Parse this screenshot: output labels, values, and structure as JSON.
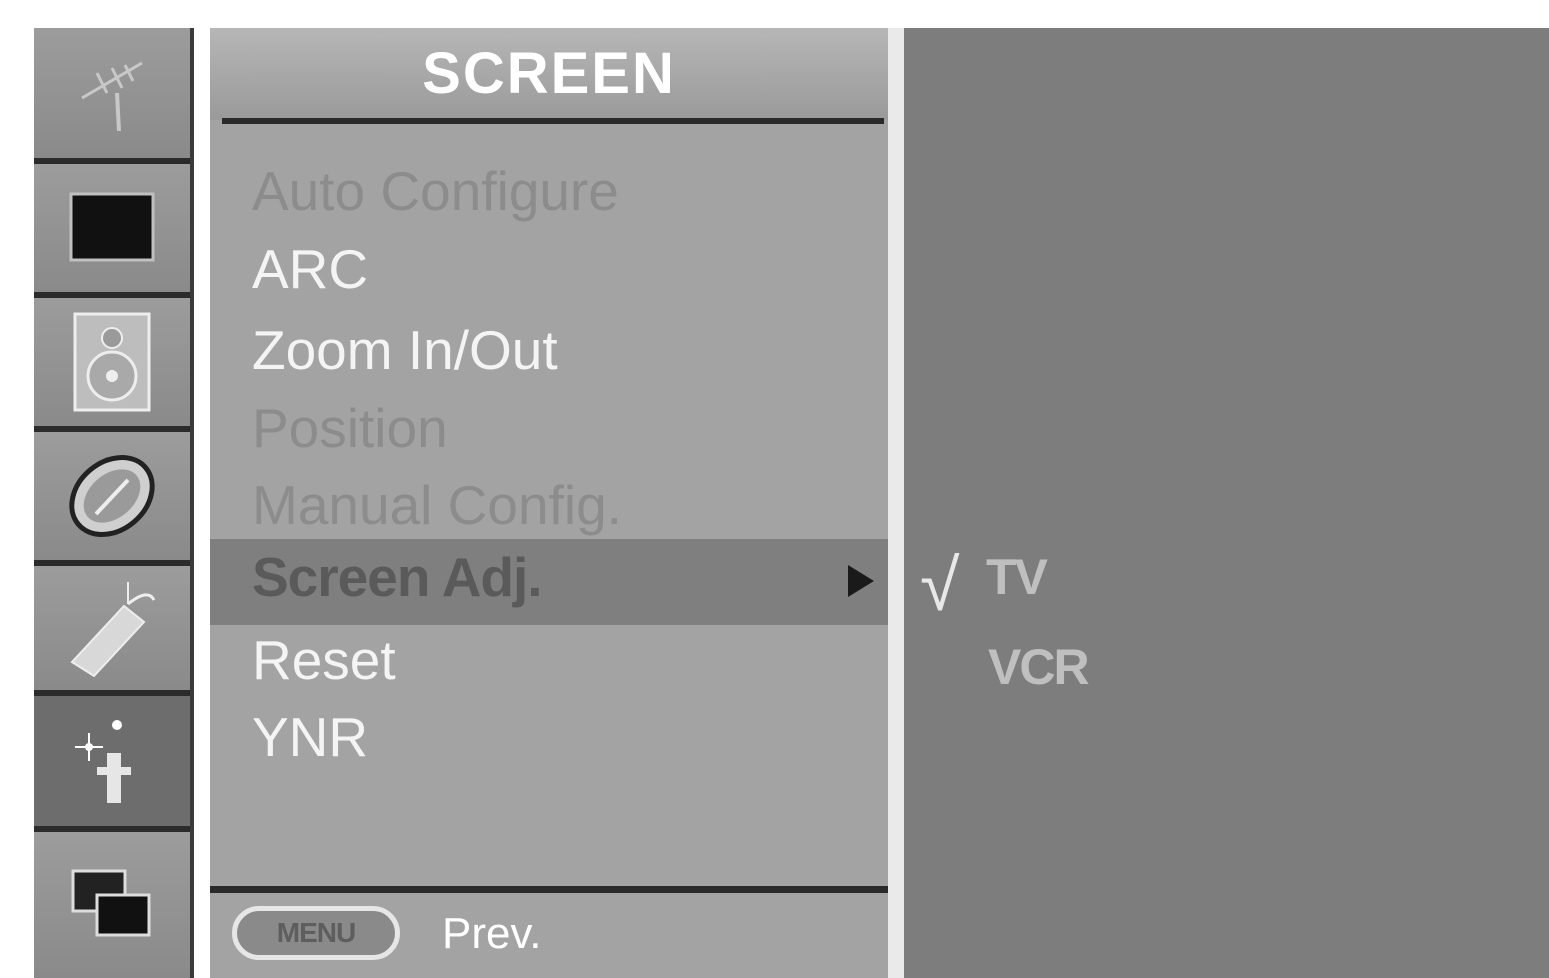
{
  "menu": {
    "title": "SCREEN",
    "items": [
      {
        "label": "Auto Configure",
        "state": "disabled"
      },
      {
        "label": "ARC",
        "state": "normal"
      },
      {
        "label": "Zoom In/Out",
        "state": "normal"
      },
      {
        "label": "Position",
        "state": "disabled"
      },
      {
        "label": "Manual Config.",
        "state": "disabled"
      },
      {
        "label": "Screen Adj.",
        "state": "selected"
      },
      {
        "label": "Reset",
        "state": "normal"
      },
      {
        "label": "YNR",
        "state": "normal"
      }
    ]
  },
  "footer": {
    "menu_button": "MENU",
    "prev_label": "Prev."
  },
  "submenu": {
    "check_mark": "√",
    "items": [
      {
        "label": "TV",
        "checked": true
      },
      {
        "label": "VCR",
        "checked": false
      }
    ]
  },
  "icons": [
    {
      "name": "antenna-icon",
      "active": false
    },
    {
      "name": "picture-icon",
      "active": false
    },
    {
      "name": "speaker-icon",
      "active": false
    },
    {
      "name": "clock-icon",
      "active": false
    },
    {
      "name": "setup-icon",
      "active": false
    },
    {
      "name": "screen-icon",
      "active": true
    },
    {
      "name": "pip-icon",
      "active": false
    }
  ]
}
